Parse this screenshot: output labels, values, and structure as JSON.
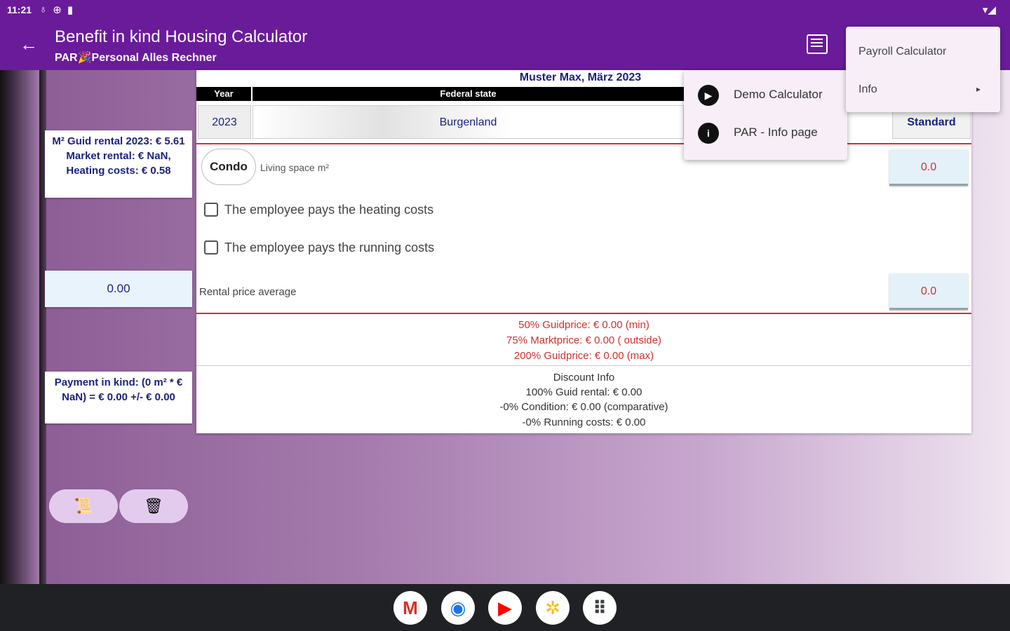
{
  "status": {
    "time": "11:21",
    "left_icons": [
      "♁",
      "⊕",
      "▮"
    ],
    "right_icons": "▾◢"
  },
  "appbar": {
    "title": "Benefit in kind Housing Calculator",
    "subtitle": "PAR🎉Personal Alles Rechner"
  },
  "left": {
    "card1": "M² Guid rental 2023: € 5.61 Market rental: € NaN, Heating costs: € 0.58",
    "card2_value": "0.00",
    "card3": "Payment in kind: (0 m² * € NaN) = € 0.00 +/- € 0.00",
    "pill1_icon": "📜",
    "pill2_icon": "🗑"
  },
  "panel": {
    "title": "Muster Max, März 2023",
    "year_header": "Year",
    "state_header": "Federal state",
    "year_value": "2023",
    "state_value": "Burgenland",
    "standard_value": "Standard",
    "condo_label": "Condo",
    "living_space_label": "Living space m²",
    "living_space_value": "0.0",
    "heating_label": "The employee pays the heating costs",
    "running_label": "The employee pays the running costs",
    "rental_label": "Rental price average",
    "rental_value": "0.0",
    "guide1": "50% Guidprice: €    0.00 (min)",
    "guide2": "75% Marktprice: €    0.00 ( outside)",
    "guide3": "200% Guidprice: €    0.00 (max)",
    "disc_title": "Discount Info",
    "disc1": "100% Guid rental: € 0.00",
    "disc2": "-0% Condition: € 0.00 (comparative)",
    "disc3": "-0% Running costs: € 0.00"
  },
  "menu1": {
    "demo": "Demo Calculator",
    "info_page": "PAR - Info page"
  },
  "menu2": {
    "payroll": "Payroll Calculator",
    "info": "Info"
  },
  "dock": [
    "M",
    "◉",
    "▶",
    "✲",
    "⠿"
  ]
}
